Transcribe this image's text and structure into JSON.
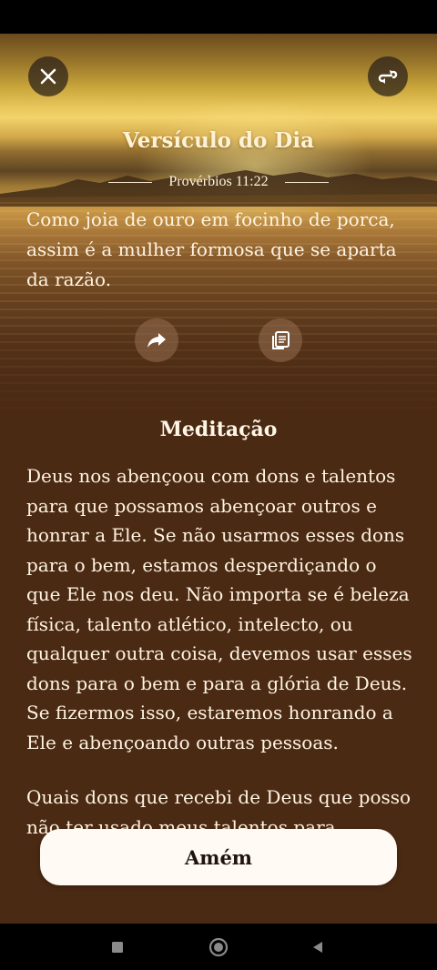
{
  "header": {
    "title": "Versículo do Dia",
    "reference": "Provérbios 11:22"
  },
  "verse": {
    "text": "Como joia de ouro em focinho de porca, assim é a mulher formosa que se aparta da razão."
  },
  "meditation": {
    "title": "Meditação",
    "paragraph1": "Deus nos abençoou com dons e talentos para que possamos abençoar outros e honrar a Ele. Se não usarmos esses dons para o bem, estamos desperdiçando o que Ele nos deu. Não importa se é beleza física, talento atlético, intelecto, ou qualquer outra coisa, devemos usar esses dons para o bem e para a glória de Deus. Se fizermos isso, estaremos honrando a Ele e abençoando outras pessoas.",
    "paragraph2": "Quais dons que recebi de Deus que posso não ter usado meus talentos para"
  },
  "buttons": {
    "amen_label": "Amém"
  },
  "icons": {
    "close": "close-icon",
    "swap": "swap-icon",
    "share": "share-icon",
    "copy": "copy-icon",
    "nav_recents": "square-icon",
    "nav_home": "circle-icon",
    "nav_back": "triangle-back-icon"
  },
  "colors": {
    "background": "#4b2a14",
    "text": "#fff4e2",
    "button": "#fffaf3"
  }
}
